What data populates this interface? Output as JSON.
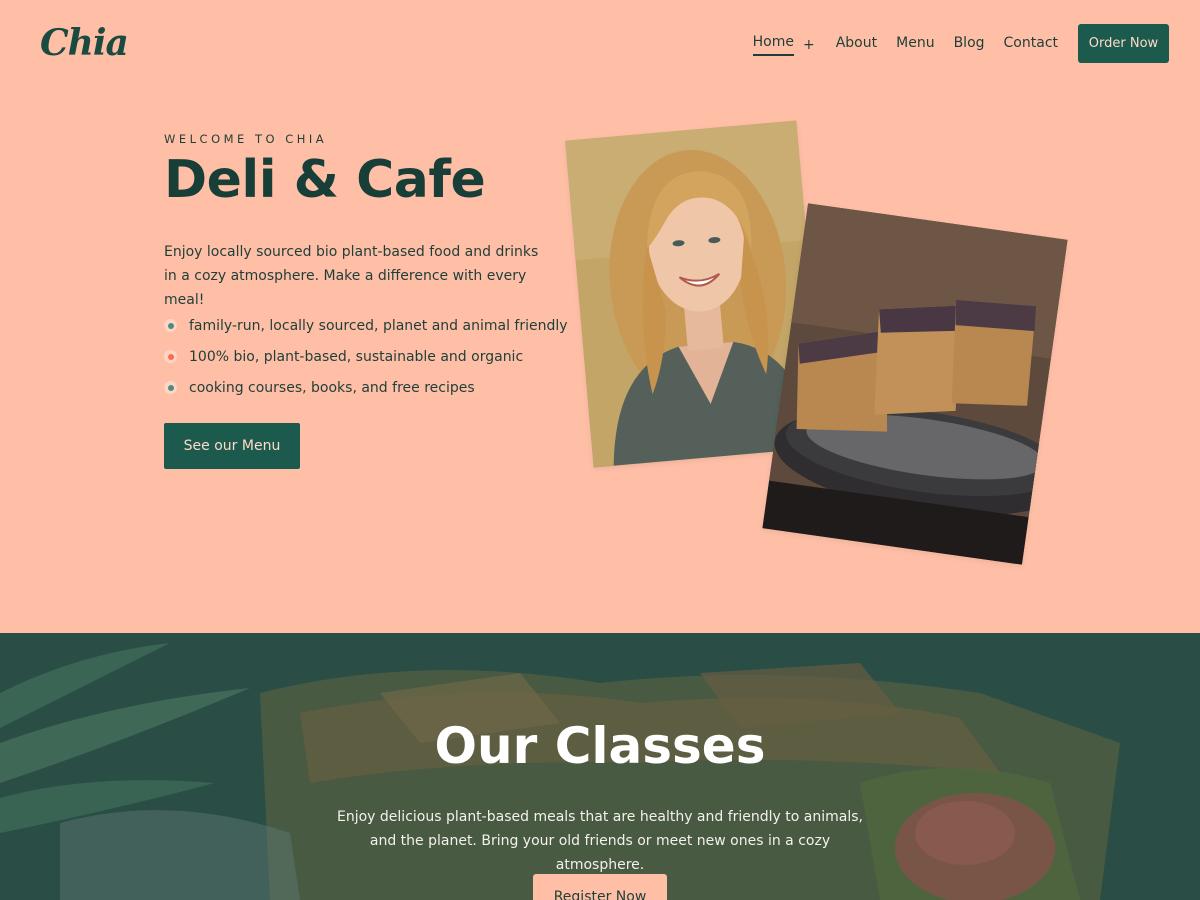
{
  "brand": {
    "logo": "Chia"
  },
  "nav": {
    "items": [
      {
        "label": "Home",
        "active": true,
        "has_submenu": true
      },
      {
        "label": "About"
      },
      {
        "label": "Menu"
      },
      {
        "label": "Blog"
      },
      {
        "label": "Contact"
      }
    ],
    "submenu_symbol": "+",
    "cta": "Order Now"
  },
  "hero": {
    "eyebrow": "WELCOME TO CHIA",
    "title": "Deli & Cafe",
    "description": "Enjoy locally sourced bio plant-based food and drinks in a cozy atmosphere. Make a difference with every meal!",
    "features": [
      {
        "text": "family-run, locally sourced, planet and animal friendly",
        "dot_color": "#4d8c7f"
      },
      {
        "text": "100% bio, plant-based, sustainable and organic",
        "dot_color": "#ff6b4a"
      },
      {
        "text": "cooking courses, books, and free recipes",
        "dot_color": "#4d8c7f"
      }
    ],
    "button": "See our Menu"
  },
  "classes": {
    "title": "Our Classes",
    "description": "Enjoy delicious plant-based meals that are healthy and friendly to animals, and the planet. Bring your old friends or meet new ones in a cozy atmosphere.",
    "button": "Register Now"
  },
  "colors": {
    "background": "#ffbfa7",
    "primary": "#1b5a4d",
    "text": "#1f3e38"
  }
}
